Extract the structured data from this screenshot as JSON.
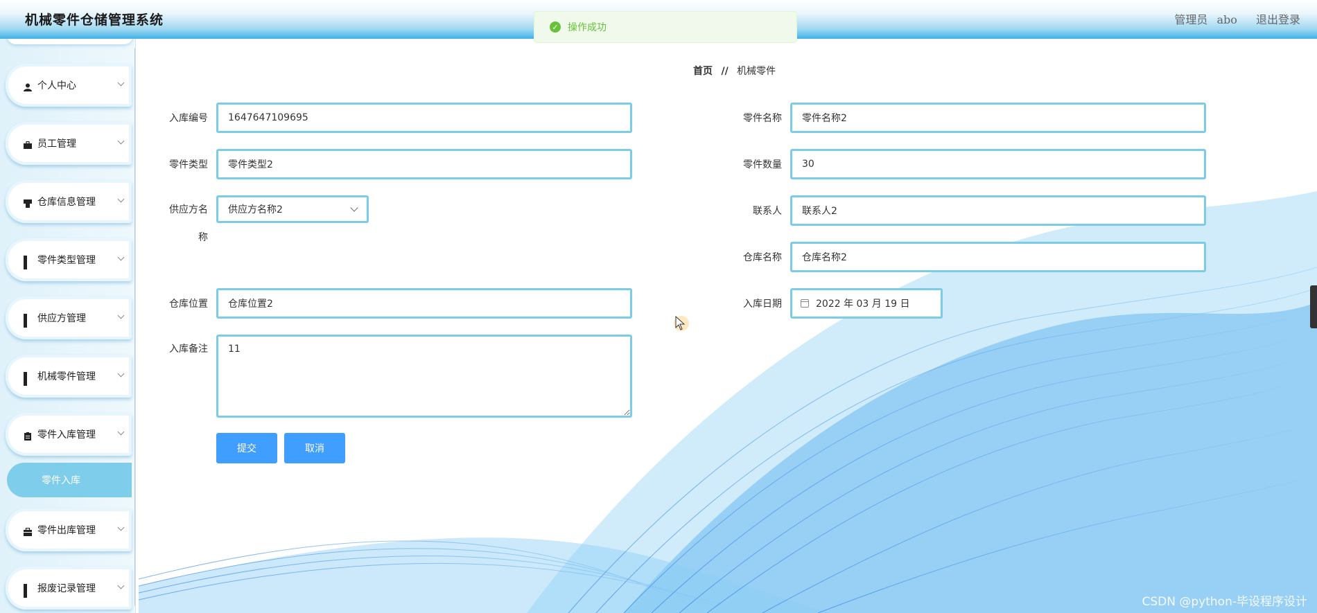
{
  "header": {
    "app_title": "机械零件仓储管理系统",
    "role": "管理员",
    "username": "abo",
    "logout_label": "退出登录"
  },
  "toast": {
    "message": "操作成功",
    "icon": "check-circle-icon",
    "color": "#67c23a"
  },
  "sidebar": {
    "items": [
      {
        "label": "个人中心",
        "icon": "user-icon"
      },
      {
        "label": "员工管理",
        "icon": "briefcase-icon"
      },
      {
        "label": "仓库信息管理",
        "icon": "warehouse-icon"
      },
      {
        "label": "零件类型管理",
        "icon": "grid-icon"
      },
      {
        "label": "供应方管理",
        "icon": "grid-icon"
      },
      {
        "label": "机械零件管理",
        "icon": "grid-icon"
      },
      {
        "label": "零件入库管理",
        "icon": "clipboard-icon"
      },
      {
        "label": "零件出库管理",
        "icon": "toolbox-icon"
      },
      {
        "label": "报废记录管理",
        "icon": "grid-icon"
      }
    ],
    "active_sub_item": "零件入库"
  },
  "breadcrumb": {
    "home": "首页",
    "separator": "//",
    "current": "机械零件"
  },
  "form": {
    "fields": {
      "inbound_no": {
        "label": "入库编号",
        "value": "1647647109695"
      },
      "part_name": {
        "label": "零件名称",
        "value": "零件名称2"
      },
      "part_type": {
        "label": "零件类型",
        "value": "零件类型2"
      },
      "part_qty": {
        "label": "零件数量",
        "value": "30"
      },
      "supplier": {
        "label_line1": "供应方名",
        "label_line2": "称",
        "value": "供应方名称2"
      },
      "contact": {
        "label": "联系人",
        "value": "联系人2"
      },
      "warehouse_name": {
        "label": "仓库名称",
        "value": "仓库名称2"
      },
      "warehouse_location": {
        "label": "仓库位置",
        "value": "仓库位置2"
      },
      "inbound_date": {
        "label": "入库日期",
        "value": "2022 年 03 月 19 日"
      },
      "remark": {
        "label": "入库备注",
        "value": "11"
      }
    },
    "submit_label": "提交",
    "cancel_label": "取消"
  },
  "watermark": "CSDN @python-毕设程序设计",
  "colors": {
    "accent": "#409eff",
    "input_border": "#7ccbe8",
    "active_menu": "#7ecdeb"
  }
}
